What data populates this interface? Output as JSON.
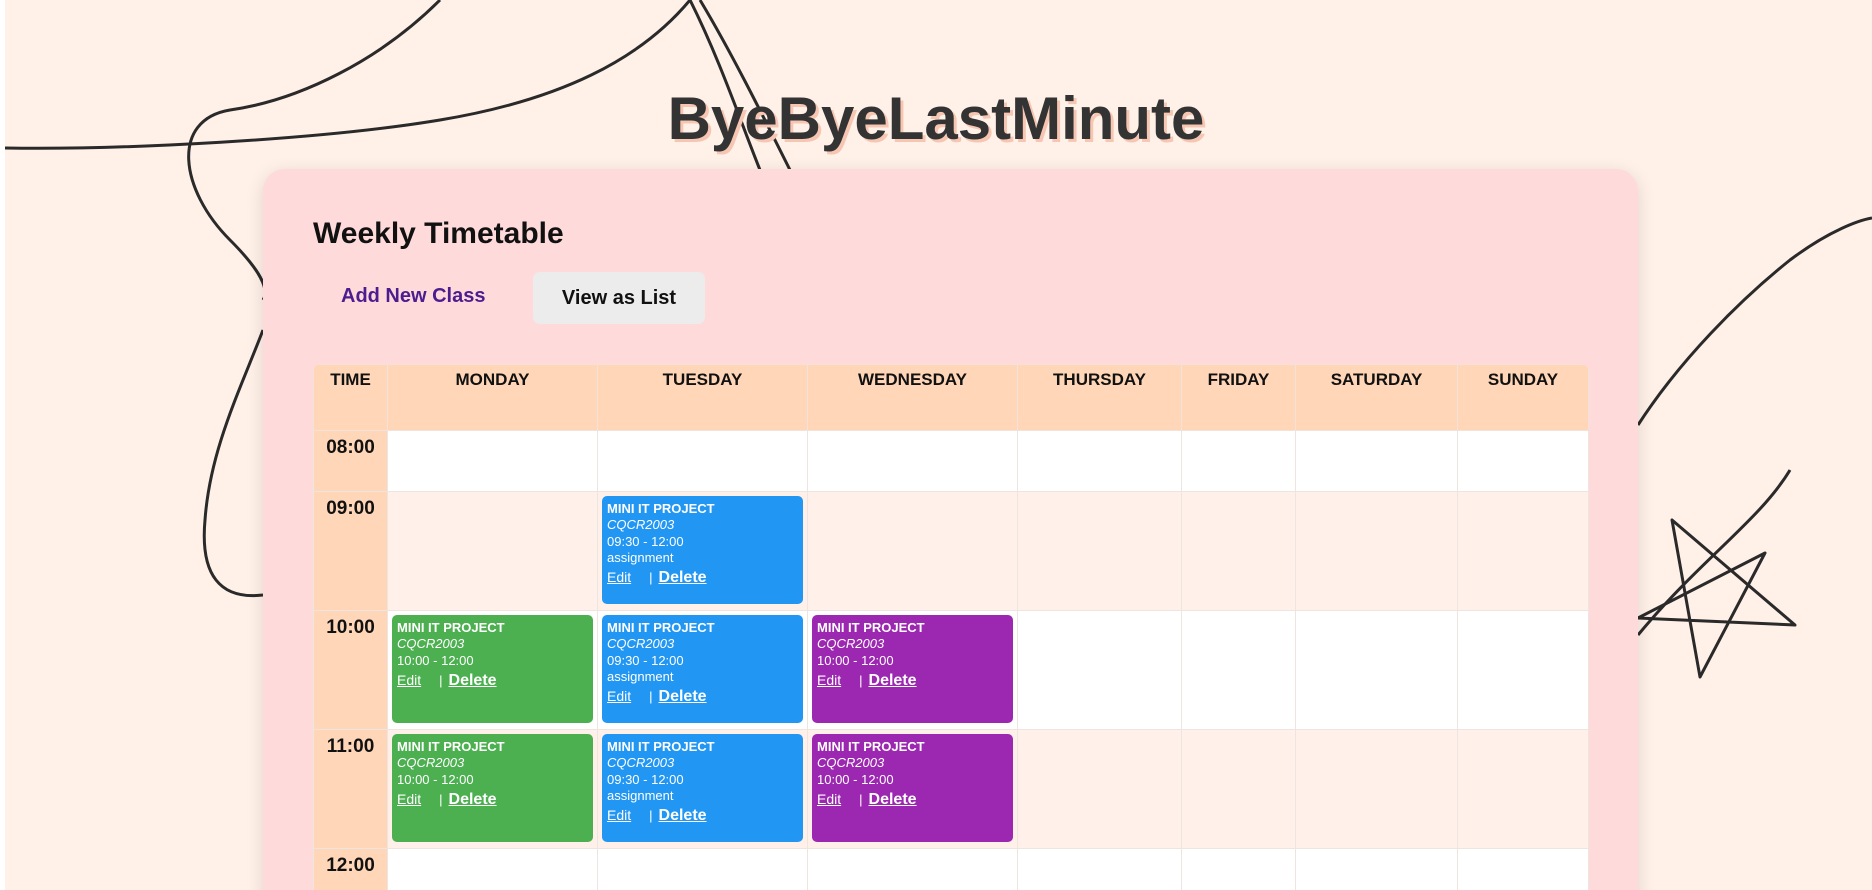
{
  "app": {
    "title": "ByeByeLastMinute"
  },
  "panel": {
    "title": "Weekly Timetable",
    "add_label": "Add New Class",
    "list_label": "View as List"
  },
  "table": {
    "headers": [
      "TIME",
      "MONDAY",
      "TUESDAY",
      "WEDNESDAY",
      "THURSDAY",
      "FRIDAY",
      "SATURDAY",
      "SUNDAY"
    ],
    "times": [
      "08:00",
      "09:00",
      "10:00",
      "11:00",
      "12:00"
    ]
  },
  "events": {
    "tue_0900": {
      "name": "MINI IT PROJECT",
      "code": "CQCR2003",
      "time": "09:30 - 12:00",
      "note": "assignment",
      "edit": "Edit",
      "sep": "|",
      "delete": "Delete"
    },
    "mon_1000": {
      "name": "MINI IT PROJECT",
      "code": "CQCR2003",
      "time": "10:00 - 12:00",
      "edit": "Edit",
      "sep": "|",
      "delete": "Delete"
    },
    "tue_1000": {
      "name": "MINI IT PROJECT",
      "code": "CQCR2003",
      "time": "09:30 - 12:00",
      "note": "assignment",
      "edit": "Edit",
      "sep": "|",
      "delete": "Delete"
    },
    "wed_1000": {
      "name": "MINI IT PROJECT",
      "code": "CQCR2003",
      "time": "10:00 - 12:00",
      "edit": "Edit",
      "sep": "|",
      "delete": "Delete"
    },
    "mon_1100": {
      "name": "MINI IT PROJECT",
      "code": "CQCR2003",
      "time": "10:00 - 12:00",
      "edit": "Edit",
      "sep": "|",
      "delete": "Delete"
    },
    "tue_1100": {
      "name": "MINI IT PROJECT",
      "code": "CQCR2003",
      "time": "09:30 - 12:00",
      "note": "assignment",
      "edit": "Edit",
      "sep": "|",
      "delete": "Delete"
    },
    "wed_1100": {
      "name": "MINI IT PROJECT",
      "code": "CQCR2003",
      "time": "10:00 - 12:00",
      "edit": "Edit",
      "sep": "|",
      "delete": "Delete"
    }
  },
  "colors": {
    "background": "#fff1e8",
    "panel": "#ffdada",
    "header": "#ffd6b8",
    "event_blue": "#2196f3",
    "event_green": "#4caf50",
    "event_purple": "#9c27b0"
  }
}
